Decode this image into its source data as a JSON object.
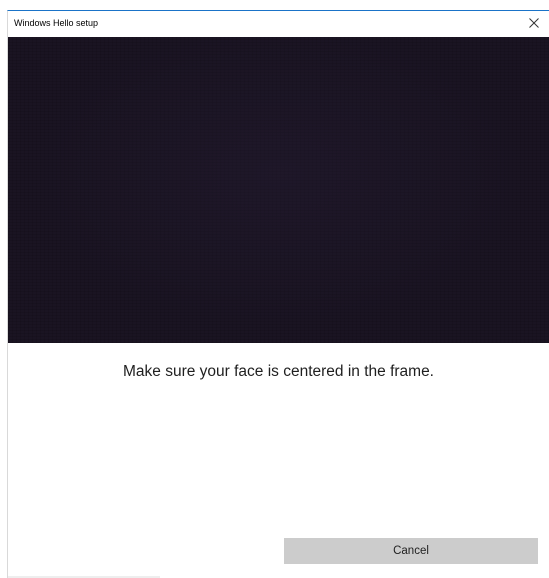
{
  "window": {
    "title": "Windows Hello setup",
    "close_icon": "close-icon",
    "accent_color": "#1a73c8"
  },
  "camera_preview": {
    "background_color": "#1a1422"
  },
  "instruction": {
    "text": "Make sure your face is centered in the frame."
  },
  "footer": {
    "cancel_label": "Cancel",
    "cancel_color": "#cccccc"
  }
}
